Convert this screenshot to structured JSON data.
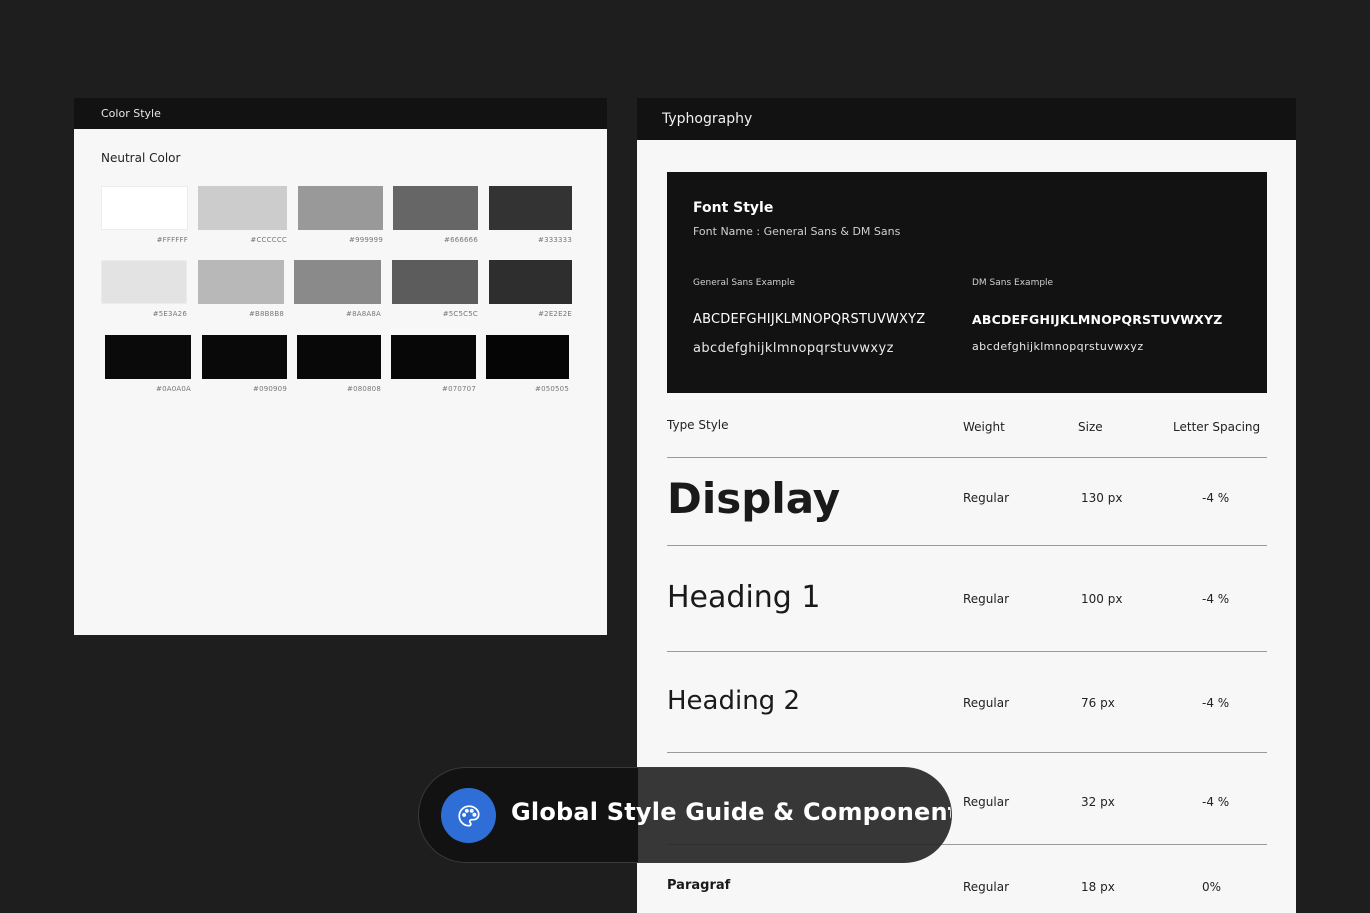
{
  "color_panel": {
    "header": "Color Style",
    "section_title": "Neutral Color",
    "swatches": [
      {
        "code": "#FFFFFF",
        "color": "#FFFFFF"
      },
      {
        "code": "#CCCCCC",
        "color": "#CCCCCC"
      },
      {
        "code": "#999999",
        "color": "#999999"
      },
      {
        "code": "#666666",
        "color": "#666666"
      },
      {
        "code": "#333333",
        "color": "#333333"
      },
      {
        "code": "#5E3A26",
        "color": "#E3E3E3"
      },
      {
        "code": "#B8B8B8",
        "color": "#B8B8B8"
      },
      {
        "code": "#8A8A8A",
        "color": "#8A8A8A"
      },
      {
        "code": "#5C5C5C",
        "color": "#5C5C5C"
      },
      {
        "code": "#2E2E2E",
        "color": "#2E2E2E"
      },
      {
        "code": "#0A0A0A",
        "color": "#0A0A0A"
      },
      {
        "code": "#090909",
        "color": "#090909"
      },
      {
        "code": "#080808",
        "color": "#080808"
      },
      {
        "code": "#070707",
        "color": "#070707"
      },
      {
        "code": "#050505",
        "color": "#050505"
      }
    ]
  },
  "typo_panel": {
    "header": "Typhography",
    "font_box": {
      "title": "Font Style",
      "subtitle": "Font Name : General Sans & DM Sans",
      "general_label": "General Sans Example",
      "general_upper": "ABCDEFGHIJKLMNOPQRSTUVWXYZ",
      "general_lower": "abcdefghijklmnopqrstuvwxyz",
      "dm_label": "DM Sans Example",
      "dm_upper": "ABCDEFGHIJKLMNOPQRSTUVWXYZ",
      "dm_lower": "abcdefghijklmnopqrstuvwxyz"
    },
    "table": {
      "headers": {
        "type_style": "Type Style",
        "weight": "Weight",
        "size": "Size",
        "letter_spacing": "Letter Spacing"
      },
      "rows": [
        {
          "name": "Display",
          "weight": "Regular",
          "size": "130 px",
          "spacing": "-4 %"
        },
        {
          "name": "Heading 1",
          "weight": "Regular",
          "size": "100 px",
          "spacing": "-4 %"
        },
        {
          "name": "Heading 2",
          "weight": "Regular",
          "size": "76 px",
          "spacing": "-4 %"
        },
        {
          "name": "",
          "weight": "Regular",
          "size": "32 px",
          "spacing": "-4 %"
        },
        {
          "name": "Paragraf",
          "weight": "Regular",
          "size": "18 px",
          "spacing": "0%"
        }
      ]
    }
  },
  "badge": {
    "icon": "palette-icon",
    "text": "Global Style Guide & Component",
    "icon_color": "#2F6ED6"
  }
}
